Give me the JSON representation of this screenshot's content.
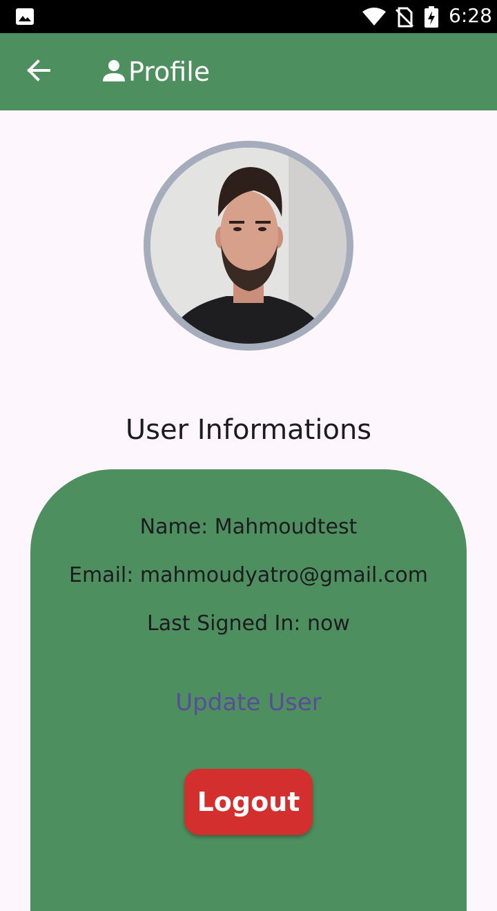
{
  "status_bar": {
    "time": "6:28",
    "icons": [
      "gallery-icon",
      "wifi-icon",
      "no-sim-icon",
      "battery-charging-icon"
    ]
  },
  "app_bar": {
    "title": "Profile",
    "back_icon": "arrow-back-icon",
    "title_icon": "person-icon",
    "color": "#4e8f5f"
  },
  "profile": {
    "avatar": "user-photo"
  },
  "section": {
    "title": "User Informations"
  },
  "user_info": {
    "name_line": "Name: Mahmoudtest",
    "email_line": "Email: mahmoudyatro@gmail.com",
    "last_signed_line": "Last Signed In: now"
  },
  "actions": {
    "update_label": "Update User",
    "logout_label": "Logout",
    "logout_color": "#d32f2f",
    "update_color": "#5a4c9a"
  }
}
